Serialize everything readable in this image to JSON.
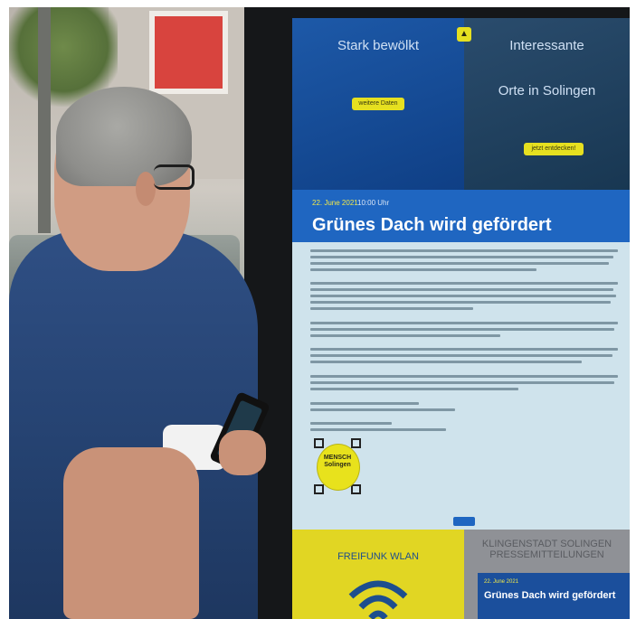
{
  "scene": {
    "description_colors": {
      "screen_blue": "#1f66c1",
      "accent_yellow": "#e6e020",
      "shirt_navy": "#2f4f84"
    }
  },
  "kiosk": {
    "weather_tile": {
      "title": "Stark bewölkt",
      "button": "weitere Daten"
    },
    "places_tile": {
      "title": "Interessante",
      "subtitle": "Orte in Solingen",
      "button": "jetzt entdecken!"
    },
    "article": {
      "date": "22. June 2021",
      "time": "10:00 Uhr",
      "title": "Grünes Dach wird gefördert"
    },
    "logo": {
      "text_line1": "MENSCH",
      "text_line2": "Solingen"
    },
    "wlan_tile": {
      "title": "FREIFUNK WLAN"
    },
    "press_tile": {
      "title_line1": "KLINGENSTADT SOLINGEN",
      "title_line2": "PRESSEMITTEILUNGEN",
      "date": "22. June 2021",
      "headline": "Grünes Dach wird gefördert"
    }
  }
}
